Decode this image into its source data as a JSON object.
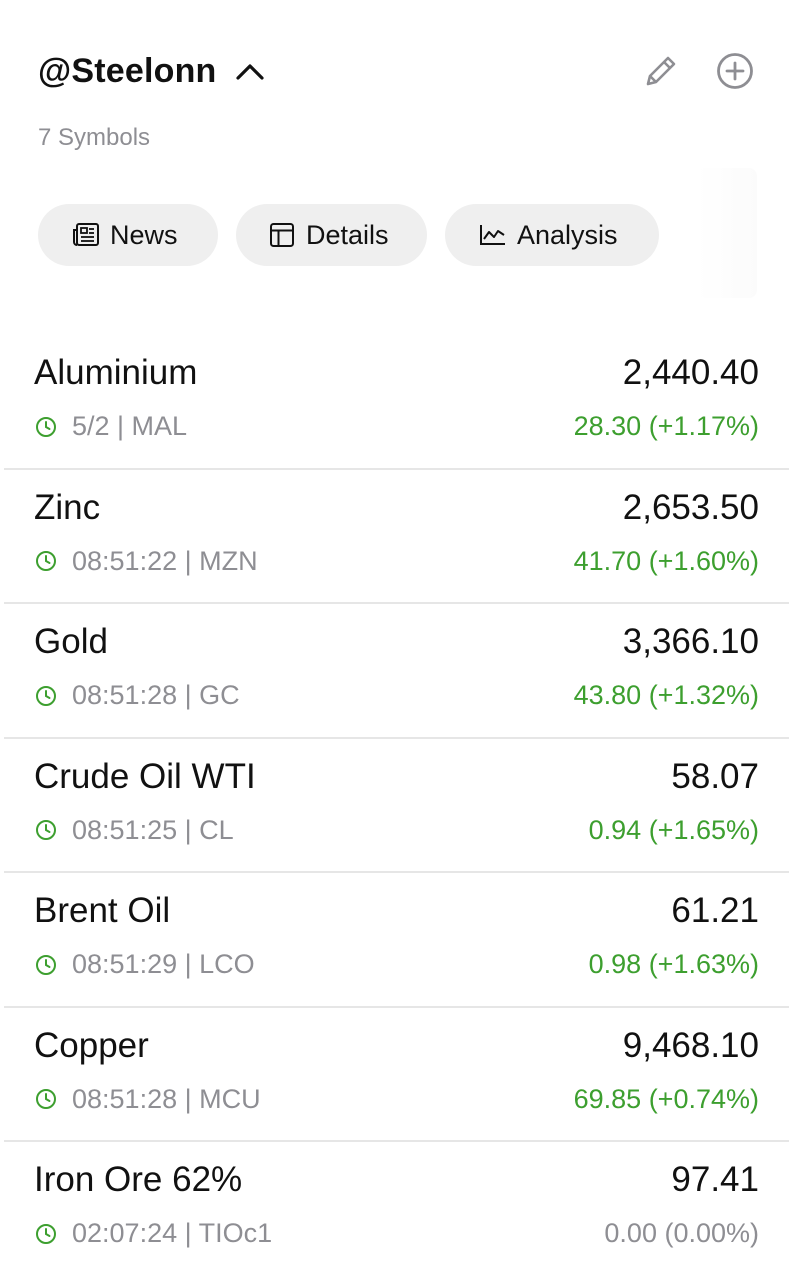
{
  "header": {
    "title": "@Steelonn",
    "subtitle": "7 Symbols"
  },
  "tabs": [
    {
      "label": "News",
      "icon": "newspaper-icon"
    },
    {
      "label": "Details",
      "icon": "table-icon"
    },
    {
      "label": "Analysis",
      "icon": "line-chart-icon"
    }
  ],
  "colors": {
    "positive": "#3d9f2f",
    "neutral": "#8e8e93",
    "tab_bg": "#efefef"
  },
  "symbols": [
    {
      "name": "Aluminium",
      "price": "2,440.40",
      "time": "5/2",
      "ticker": "MAL",
      "meta": "5/2 | MAL",
      "change": "28.30 (+1.17%)",
      "trend": "positive"
    },
    {
      "name": "Zinc",
      "price": "2,653.50",
      "time": "08:51:22",
      "ticker": "MZN",
      "meta": "08:51:22 | MZN",
      "change": "41.70 (+1.60%)",
      "trend": "positive"
    },
    {
      "name": "Gold",
      "price": "3,366.10",
      "time": "08:51:28",
      "ticker": "GC",
      "meta": "08:51:28 | GC",
      "change": "43.80 (+1.32%)",
      "trend": "positive"
    },
    {
      "name": "Crude Oil WTI",
      "price": "58.07",
      "time": "08:51:25",
      "ticker": "CL",
      "meta": "08:51:25 | CL",
      "change": "0.94 (+1.65%)",
      "trend": "positive"
    },
    {
      "name": "Brent Oil",
      "price": "61.21",
      "time": "08:51:29",
      "ticker": "LCO",
      "meta": "08:51:29 | LCO",
      "change": "0.98 (+1.63%)",
      "trend": "positive"
    },
    {
      "name": "Copper",
      "price": "9,468.10",
      "time": "08:51:28",
      "ticker": "MCU",
      "meta": "08:51:28 | MCU",
      "change": "69.85 (+0.74%)",
      "trend": "positive"
    },
    {
      "name": "Iron Ore 62%",
      "price": "97.41",
      "time": "02:07:24",
      "ticker": "TIOc1",
      "meta": "02:07:24 | TIOc1",
      "change": "0.00 (0.00%)",
      "trend": "neutral"
    }
  ]
}
